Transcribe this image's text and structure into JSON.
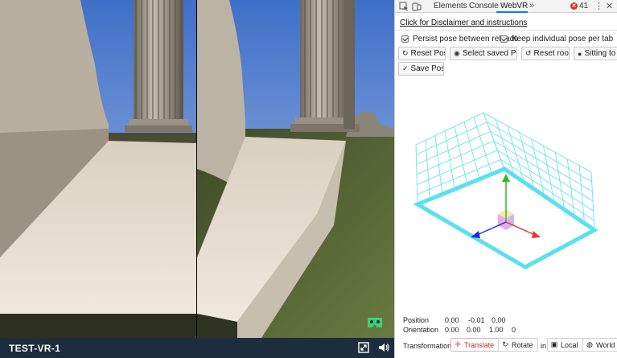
{
  "vr": {
    "title": "TEST-VR-1",
    "icons": [
      "fullscreen-icon",
      "volume-icon",
      "cardboard-icon"
    ]
  },
  "devtools": {
    "tabs": [
      {
        "label": "Elements"
      },
      {
        "label": "Console"
      },
      {
        "label": "WebVR"
      }
    ],
    "active_tab": "WebVR",
    "more_tabs": "»",
    "error_count": "41",
    "kebab": "⋮",
    "close": "✕",
    "disclaimer": "Click for Disclaimer and instructions",
    "options": {
      "persist_pose": "Persist pose between reloads",
      "keep_individual": "Keep individual pose per tab"
    },
    "buttons": {
      "reset_pose": "Reset Pose",
      "select_saved": "Select saved Pose",
      "reset_room": "Reset room",
      "sitting": "Sitting to sta",
      "save_pose": "Save Pose"
    },
    "position": {
      "label": "Position",
      "values": [
        "0.00",
        "-0.01",
        "0.00"
      ]
    },
    "orientation": {
      "label": "Orientation",
      "values": [
        "0.00",
        "0.00",
        "1.00",
        "0"
      ]
    },
    "transformation": {
      "label": "Transformation",
      "translate": "Translate",
      "rotate": "Rotate",
      "in": "in",
      "local": "Local",
      "world": "World"
    },
    "colors": {
      "grid": "#5ae0f0",
      "axis_x": "#e53935",
      "axis_y": "#2eb82e",
      "axis_z": "#1d2fd6",
      "tab_accent": "#1a73e8"
    }
  }
}
